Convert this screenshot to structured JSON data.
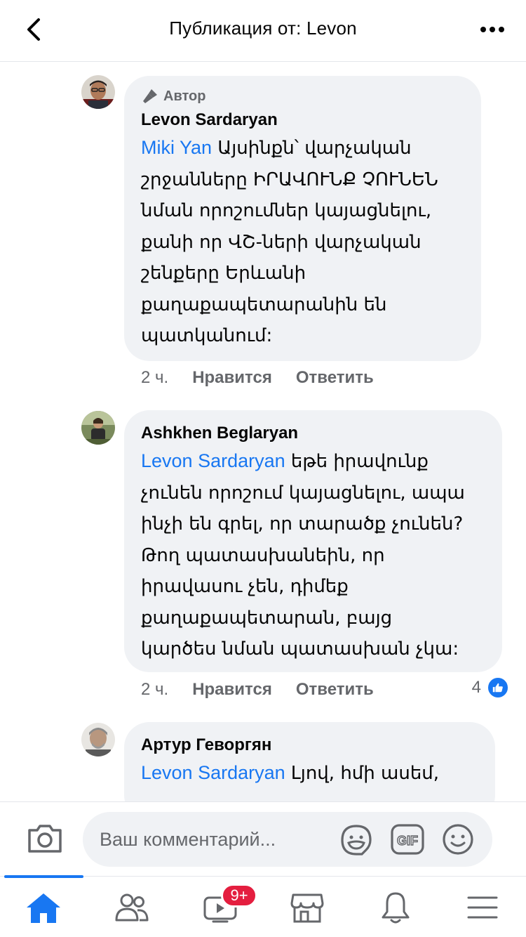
{
  "header": {
    "title": "Публикация от: Levon"
  },
  "comments": [
    {
      "author_badge": "Автор",
      "name": "Levon Sardaryan",
      "mention": "Miki Yan",
      "text_lines": [
        " Այսինքն՝ վարչական",
        "շրջանները ԻՐԱՎՈՒՆՔ ՉՈՒՆԵՆ",
        "նման որոշումներ կայացնելու,",
        "քանի որ ՎՇ-ների վարչական",
        "շենքերը Երևանի",
        "քաղաքապետարանին են",
        "պատկանում:"
      ],
      "time": "2 ч.",
      "like_label": "Нравится",
      "reply_label": "Ответить"
    },
    {
      "name": "Ashkhen Beglaryan",
      "mention": "Levon Sardaryan",
      "text_lines": [
        " եթե իրավունք",
        "չունեն որոշում կայացնելու, ապա",
        "ինչի են գրել, որ տարածք չունեն?",
        "Թող պատասխանեին, որ",
        "իրավասու չեն, դիմեք",
        "քաղաքապետարան, բայց",
        "կարծես նման պատասխան չկա:"
      ],
      "time": "2 ч.",
      "like_label": "Нравится",
      "reply_label": "Ответить",
      "reaction_count": "4"
    },
    {
      "name": "Артур Геворгян",
      "mention": "Levon Sardaryan",
      "text_lines": [
        " Լյով, հմի ասեմ,"
      ]
    }
  ],
  "composer": {
    "placeholder": "Ваш комментарий..."
  },
  "nav": {
    "video_badge": "9+"
  },
  "colors": {
    "accent": "#1877f2",
    "bubble": "#f0f2f5",
    "secondary_text": "#65676b",
    "badge": "#e41e3f"
  }
}
